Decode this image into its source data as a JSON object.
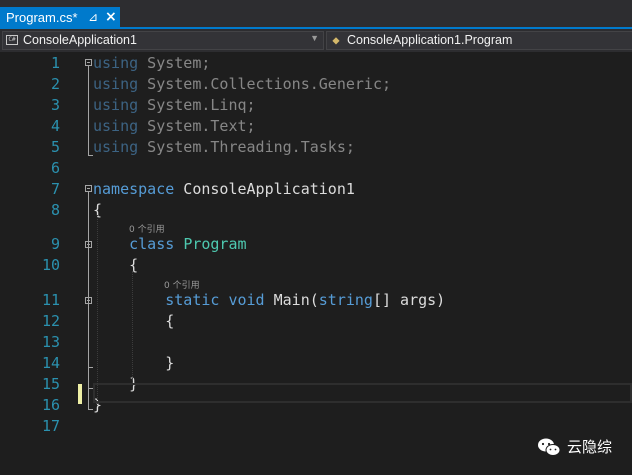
{
  "tab": {
    "title": "Program.cs*",
    "pin_icon": "pin-icon",
    "close_icon": "close-icon"
  },
  "navbar": {
    "project": {
      "icon_text": "C#",
      "label": "ConsoleApplication1"
    },
    "type": {
      "label": "ConsoleApplication1.Program"
    }
  },
  "editor": {
    "lines": [
      {
        "num": "1",
        "tokens": [
          {
            "t": "using",
            "c": "kw dim"
          },
          {
            "t": " System;",
            "c": "dim"
          }
        ]
      },
      {
        "num": "2",
        "tokens": [
          {
            "t": "using",
            "c": "kw dim"
          },
          {
            "t": " System.Collections.Generic;",
            "c": "dim"
          }
        ]
      },
      {
        "num": "3",
        "tokens": [
          {
            "t": "using",
            "c": "kw dim"
          },
          {
            "t": " System.Linq;",
            "c": "dim"
          }
        ]
      },
      {
        "num": "4",
        "tokens": [
          {
            "t": "using",
            "c": "kw dim"
          },
          {
            "t": " System.Text;",
            "c": "dim"
          }
        ]
      },
      {
        "num": "5",
        "tokens": [
          {
            "t": "using",
            "c": "kw dim"
          },
          {
            "t": " System.Threading.Tasks;",
            "c": "dim"
          }
        ]
      },
      {
        "num": "6",
        "tokens": []
      },
      {
        "num": "7",
        "tokens": [
          {
            "t": "namespace",
            "c": "kw"
          },
          {
            "t": " ConsoleApplication1",
            "c": ""
          }
        ]
      },
      {
        "num": "8",
        "tokens": [
          {
            "t": "{",
            "c": ""
          }
        ]
      },
      {
        "num": "9",
        "tokens": [
          {
            "t": "    ",
            "c": ""
          },
          {
            "t": "class",
            "c": "kw"
          },
          {
            "t": " ",
            "c": ""
          },
          {
            "t": "Program",
            "c": "ty"
          }
        ]
      },
      {
        "num": "10",
        "tokens": [
          {
            "t": "    {",
            "c": ""
          }
        ]
      },
      {
        "num": "11",
        "tokens": [
          {
            "t": "        ",
            "c": ""
          },
          {
            "t": "static",
            "c": "kw"
          },
          {
            "t": " ",
            "c": ""
          },
          {
            "t": "void",
            "c": "kw"
          },
          {
            "t": " Main(",
            "c": ""
          },
          {
            "t": "string",
            "c": "kw"
          },
          {
            "t": "[] args)",
            "c": ""
          }
        ]
      },
      {
        "num": "12",
        "tokens": [
          {
            "t": "        {",
            "c": ""
          }
        ]
      },
      {
        "num": "13",
        "tokens": []
      },
      {
        "num": "14",
        "tokens": [
          {
            "t": "        }",
            "c": ""
          }
        ]
      },
      {
        "num": "15",
        "tokens": [
          {
            "t": "    }",
            "c": ""
          }
        ]
      },
      {
        "num": "16",
        "tokens": [
          {
            "t": "}",
            "c": ""
          }
        ]
      },
      {
        "num": "17",
        "tokens": []
      }
    ],
    "codelens": {
      "class_refs": "0 个引用",
      "method_refs": "0 个引用"
    }
  },
  "colors": {
    "keyword": "#569cd6",
    "type": "#4ec9b0",
    "line_number": "#2b91af",
    "accent": "#007acc",
    "change_bar": "#eff0a6"
  },
  "watermark": {
    "text": "云隐综",
    "icon": "wechat-logo-icon"
  }
}
